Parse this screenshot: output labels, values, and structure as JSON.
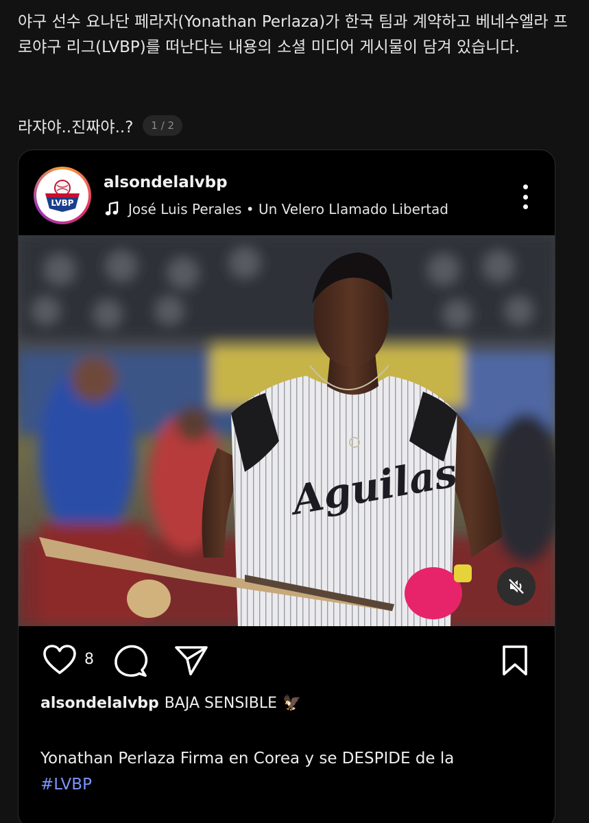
{
  "description": "야구 선수 요나단 페라자(Yonathan Perlaza)가 한국 팀과 계약하고 베네수엘라 프로야구 리그(LVBP)를 떠난다는 내용의 소셜 미디어 게시물이 담겨 있습니다.",
  "comment": "라쟈야..진짜야..?",
  "pager": "1 / 2",
  "post": {
    "username": "alsondelalvbp",
    "avatar_badge": "LVBP",
    "music": "José Luis Perales • Un Velero Llamado Libertad",
    "photo_jersey_text": "Aguilas",
    "likes": "8",
    "caption_user": "alsondelalvbp",
    "caption_text": "BAJA SENSIBLE",
    "caption_emoji": "🦅",
    "body": "Yonathan Perlaza Firma en Corea y se DESPIDE  de la",
    "hashtag": "#LVBP"
  },
  "colors": {
    "background": "#121212",
    "card": "#000000",
    "hashtag": "#7b96ff",
    "avatar_ring": [
      "#f9a13a",
      "#e1306c",
      "#9b36b7"
    ]
  },
  "icons": [
    "music-icon",
    "more-icon",
    "mute-icon",
    "heart-icon",
    "comment-icon",
    "share-icon",
    "bookmark-icon"
  ]
}
